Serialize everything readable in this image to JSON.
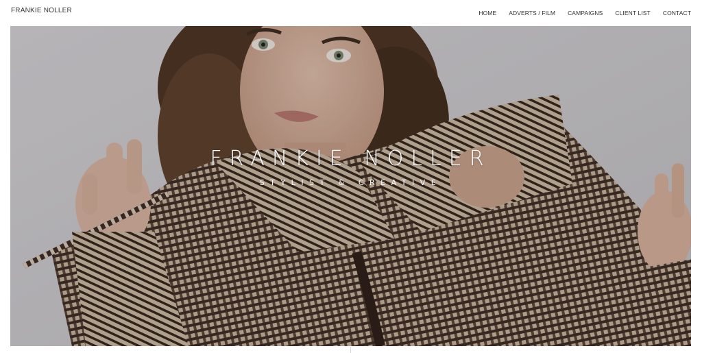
{
  "site": {
    "logo": "FRANKIE NOLLER"
  },
  "nav": {
    "items": [
      {
        "label": "HOME"
      },
      {
        "label": "ADVERTS / FILM"
      },
      {
        "label": "CAMPAIGNS"
      },
      {
        "label": "CLIENT LIST"
      },
      {
        "label": "CONTACT"
      }
    ]
  },
  "hero": {
    "title": "FRANKIE NOLLER",
    "subtitle": "STYLIST & CREATIVE",
    "image_description_icon": "portrait-photo"
  }
}
